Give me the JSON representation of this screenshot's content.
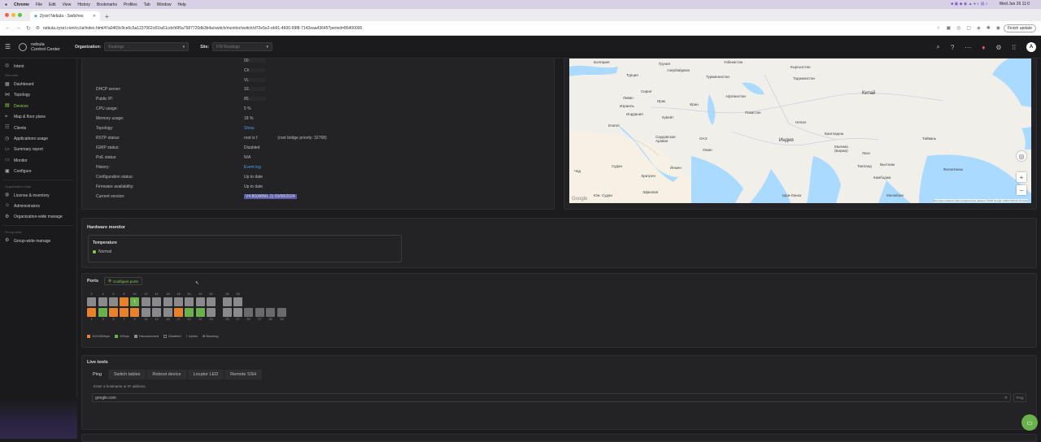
{
  "macbar": {
    "menus": [
      "Chrome",
      "File",
      "Edit",
      "View",
      "History",
      "Bookmarks",
      "Profiles",
      "Tab",
      "Window",
      "Help"
    ],
    "clock": "Wed Jun 26  11:0"
  },
  "tab": {
    "title": "Zyxel Nebula - Switches",
    "new_tab": "+"
  },
  "address": {
    "url": "nebula.zyxel.com/cc/ui/index.html#!/a0469c9ce6c5a1237062c81/a61cdcfd95a7587720db3b4a/switch/monitor/switch/d72e5e2-eb91-4600-99f8-7142eaa43645?period=86400000",
    "finish_update": "Finish update"
  },
  "appbar": {
    "brand_line1": "nebula",
    "brand_line2": "Control Center",
    "org_label": "Organization:",
    "org_value": "Keatings",
    "site_label": "Site:",
    "site_value": "FW Routings",
    "avatar": "A"
  },
  "sidebar": {
    "intent": "Intent",
    "site_section": "Site-wide",
    "items": [
      "Dashboard",
      "Topology",
      "Devices",
      "Map & floor plans",
      "Clients",
      "Applications usage",
      "Summary report",
      "Monitor",
      "Configure"
    ],
    "org_section": "Organization-wide",
    "org_items": [
      "License & inventory",
      "Administrators",
      "Organization-wide manage"
    ],
    "group_section": "Group-wide",
    "group_items": [
      "Group-wide manage"
    ]
  },
  "info": {
    "top_values": [
      "00:",
      "Ch",
      "VL"
    ],
    "rows": [
      {
        "k": "DHCP server:",
        "v": "10."
      },
      {
        "k": "Public IP:",
        "v": "85."
      },
      {
        "k": "CPU usage:",
        "v": "5 %"
      },
      {
        "k": "Memory usage:",
        "v": "18 %"
      },
      {
        "k": "Topology:",
        "v": "Show"
      },
      {
        "k": "RSTP status:",
        "v": "root is f                  (root bridge priority: 32768)"
      },
      {
        "k": "IGMP status:",
        "v": "Disabled"
      },
      {
        "k": "PoE status:",
        "v": "N/A"
      },
      {
        "k": "History:",
        "v": "Event log"
      },
      {
        "k": "Configuration status:",
        "v": "Up to date"
      },
      {
        "k": "Firmware availability:",
        "v": "Up to date"
      },
      {
        "k": "Current version:",
        "v": "V4.80(ABML.2) 03/08/2024"
      }
    ]
  },
  "map": {
    "labels": [
      "Болгария",
      "Грузия",
      "Туркменистан",
      "Узбекистан",
      "Кыргызстан",
      "Турция",
      "Азербайджан",
      "Таджикистан",
      "Сирия",
      "Ирак",
      "Ливан",
      "Израиль",
      "Иран",
      "Афганистан",
      "Китай",
      "Иордания",
      "Кувейт",
      "Пакистан",
      "Непал",
      "Египет",
      "Саудовская Аравия",
      "ОАЭ",
      "Индия",
      "Мьянма (Бирма)",
      "Лаос",
      "Бангладеш",
      "Тайвань",
      "Оман",
      "Таиланд",
      "Судан",
      "Эритрея",
      "Йемен",
      "Вьетнам",
      "Чад",
      "Филиппины",
      "Камбоджа",
      "Юж. Судан",
      "Эфиопия",
      "Шри-Ланка",
      "Малайзия"
    ],
    "zoom_in": "+",
    "zoom_out": "−",
    "google": "Google",
    "attribution": "Быстрые клавиши   Картографические данные ©2025 Google, INEGI   500 км   Условия"
  },
  "hardware": {
    "title": "Hardware monitor",
    "temp_label": "Temperature",
    "temp_status": "Normal"
  },
  "ports": {
    "title": "Ports",
    "configure": "Configure ports",
    "top_nums": [
      "2",
      "4",
      "6",
      "8",
      "10",
      "12",
      "14",
      "16",
      "18",
      "20",
      "22",
      "24",
      "26",
      "28"
    ],
    "bottom_nums": [
      "1",
      "3",
      "5",
      "7",
      "9",
      "11",
      "13",
      "15",
      "17",
      "19",
      "21",
      "23",
      "25",
      "27",
      "25",
      "27",
      "28"
    ],
    "legend": [
      "10/100Mbps",
      "1Gbps",
      "Disconnected",
      "Disabled",
      "Uplink",
      "Blocking"
    ],
    "colors": {
      "orange": "#e8822a",
      "green": "#6ab04c",
      "gray": "#8a8a8c",
      "dark": "#232325"
    }
  },
  "livetools": {
    "title": "Live tools",
    "tabs": [
      "Ping",
      "Switch tables",
      "Reboot device",
      "Locator LED",
      "Remote SSH"
    ],
    "input_label": "Enter a hostname or IP address.",
    "input_value": "google.com",
    "ping_button": "Ping"
  }
}
